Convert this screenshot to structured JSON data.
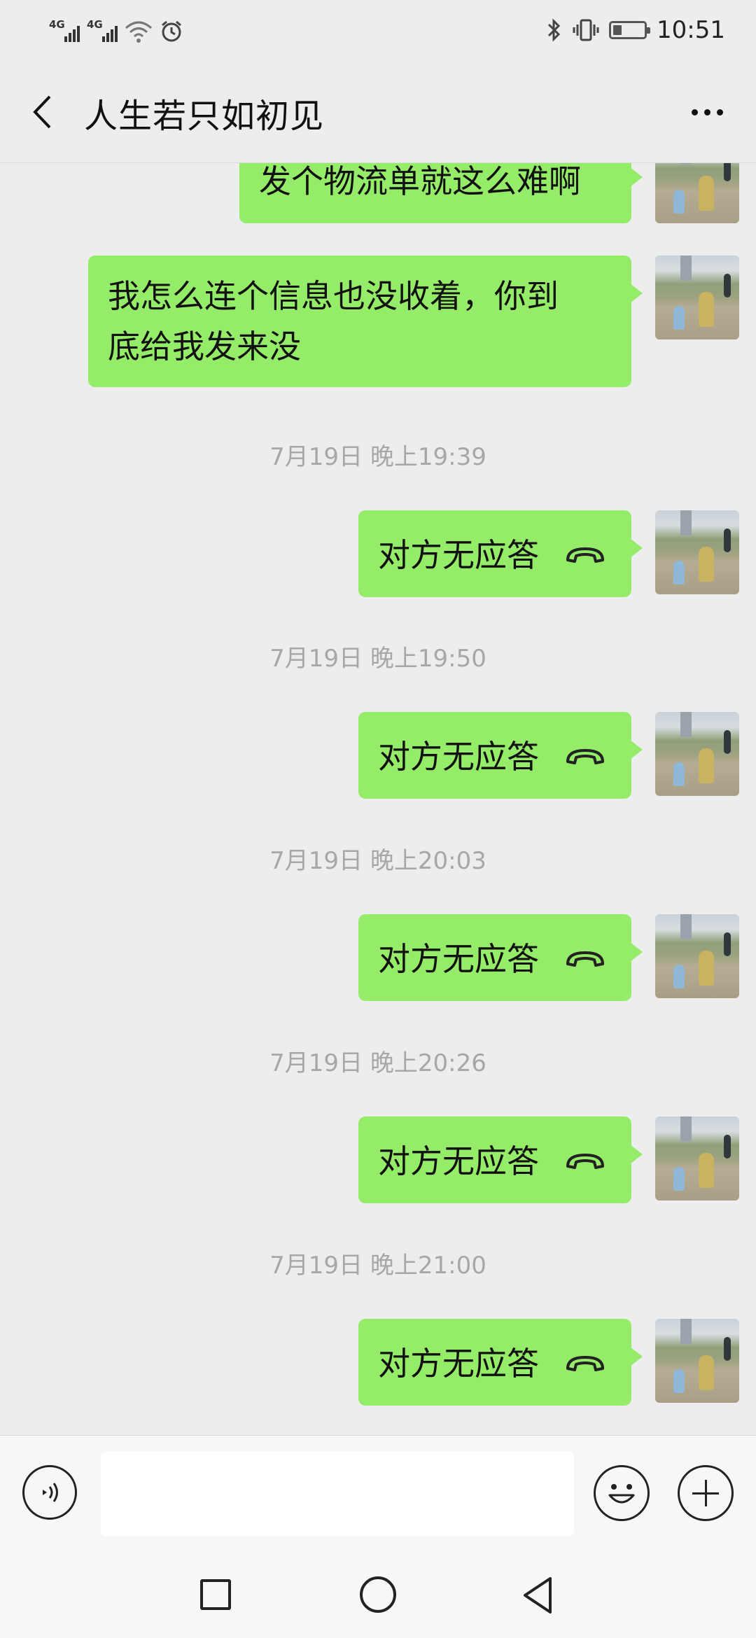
{
  "status_bar": {
    "network1": "4G",
    "network2": "4G",
    "time": "10:51",
    "icons": [
      "signal-icon",
      "signal-icon",
      "wifi-icon",
      "alarm-icon",
      "bluetooth-icon",
      "vibrate-icon",
      "battery-icon"
    ]
  },
  "header": {
    "title": "人生若只如初见",
    "back_icon": "chevron-left-icon",
    "more_icon": "more-dots-icon"
  },
  "messages": [
    {
      "type": "text",
      "text": "发个物流单就这么难啊",
      "sender": "me"
    },
    {
      "type": "text",
      "text_lines": [
        "我怎么连个信息也没收着，你到",
        "底给我发来没"
      ],
      "sender": "me"
    },
    {
      "type": "timestamp",
      "text": "7月19日 晚上19:39"
    },
    {
      "type": "call",
      "text": "对方无应答",
      "icon": "hangup-icon",
      "sender": "me"
    },
    {
      "type": "timestamp",
      "text": "7月19日 晚上19:50"
    },
    {
      "type": "call",
      "text": "对方无应答",
      "icon": "hangup-icon",
      "sender": "me"
    },
    {
      "type": "timestamp",
      "text": "7月19日 晚上20:03"
    },
    {
      "type": "call",
      "text": "对方无应答",
      "icon": "hangup-icon",
      "sender": "me"
    },
    {
      "type": "timestamp",
      "text": "7月19日 晚上20:26"
    },
    {
      "type": "call",
      "text": "对方无应答",
      "icon": "hangup-icon",
      "sender": "me"
    },
    {
      "type": "timestamp",
      "text": "7月19日 晚上21:00"
    },
    {
      "type": "call",
      "text": "对方无应答",
      "icon": "hangup-icon",
      "sender": "me"
    }
  ],
  "input_bar": {
    "value": "",
    "icons": [
      "voice-icon",
      "emoji-icon",
      "plus-icon"
    ]
  },
  "nav_bar": {
    "icons": [
      "recents-square-icon",
      "home-circle-icon",
      "back-triangle-icon"
    ]
  },
  "colors": {
    "bubble": "#95EC69",
    "background": "#EDEDED",
    "timestamp": "#A7A7A7"
  }
}
